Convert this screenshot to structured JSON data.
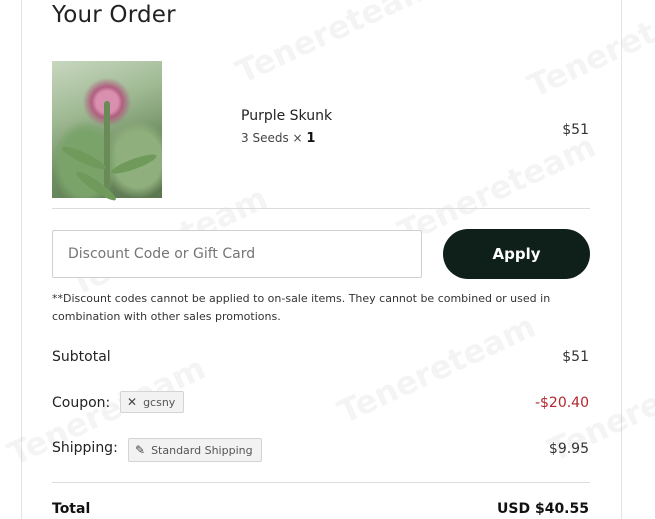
{
  "order": {
    "title": "Your Order",
    "item": {
      "name": "Purple Skunk",
      "variant": "3 Seeds",
      "qty_sep": " × ",
      "qty": "1",
      "price": "$51"
    }
  },
  "discount": {
    "placeholder": "Discount Code or Gift Card",
    "value": "",
    "apply_label": "Apply",
    "disclaimer": "**Discount codes cannot be applied to on-sale items. They cannot be combined or used in combination with other sales promotions."
  },
  "summary": {
    "subtotal_label": "Subtotal",
    "subtotal_value": "$51",
    "coupon_label": "Coupon:",
    "coupon_code": "gcsny",
    "coupon_value": "-$20.40",
    "shipping_label": "Shipping:",
    "shipping_method": "Standard Shipping",
    "shipping_value": "$9.95",
    "total_label": "Total",
    "total_value": "USD $40.55"
  },
  "watermark": {
    "text": "Tenereteam"
  },
  "colors": {
    "apply_button": "#0f1f1a",
    "coupon_discount": "#b3262e"
  },
  "icons": {
    "remove_coupon": "close-icon",
    "shipping_edit": "edit-icon"
  }
}
